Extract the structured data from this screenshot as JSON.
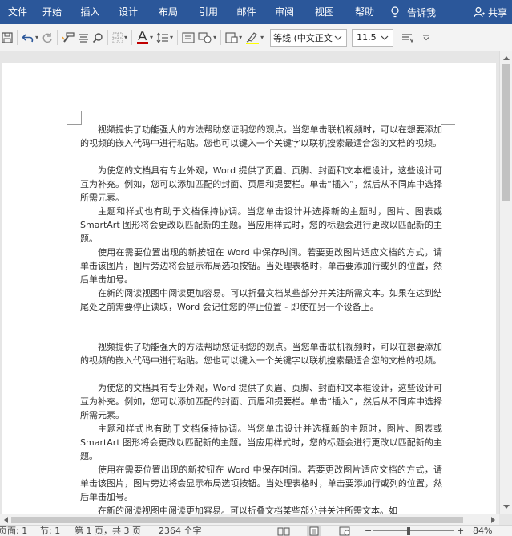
{
  "ribbon": {
    "tabs": [
      "文件",
      "开始",
      "插入",
      "设计",
      "布局",
      "引用",
      "邮件",
      "审阅",
      "视图",
      "帮助"
    ],
    "tell_me": "告诉我",
    "share": "共享"
  },
  "toolbar": {
    "font_name": "等线 (中文正文",
    "font_size": "11.5",
    "font_color": "#c00000",
    "highlight_color": "#ffff00"
  },
  "document": {
    "paragraphs": [
      "视频提供了功能强大的方法帮助您证明您的观点。当您单击联机视频时，可以在想要添加的视频的嵌入代码中进行粘贴。您也可以键入一个关键字以联机搜索最适合您的文档的视频。",
      "为使您的文档具有专业外观，Word 提供了页眉、页脚、封面和文本框设计，这些设计可互为补充。例如，您可以添加匹配的封面、页眉和提要栏。单击“插入”，然后从不同库中选择所需元素。",
      "主题和样式也有助于文档保持协调。当您单击设计并选择新的主题时，图片、图表或 SmartArt 图形将会更改以匹配新的主题。当应用样式时，您的标题会进行更改以匹配新的主题。",
      "使用在需要位置出现的新按钮在 Word 中保存时间。若要更改图片适应文档的方式，请单击该图片，图片旁边将会显示布局选项按钮。当处理表格时，单击要添加行或列的位置，然后单击加号。",
      "在新的阅读视图中阅读更加容易。可以折叠文档某些部分并关注所需文本。如果在达到结尾处之前需要停止读取，Word 会记住您的停止位置 - 即使在另一个设备上。",
      "视频提供了功能强大的方法帮助您证明您的观点。当您单击联机视频时，可以在想要添加的视频的嵌入代码中进行粘贴。您也可以键入一个关键字以联机搜索最适合您的文档的视频。",
      "为使您的文档具有专业外观，Word 提供了页眉、页脚、封面和文本框设计，这些设计可互为补充。例如，您可以添加匹配的封面、页眉和提要栏。单击“插入”，然后从不同库中选择所需元素。",
      "主题和样式也有助于文档保持协调。当您单击设计并选择新的主题时，图片、图表或 SmartArt 图形将会更改以匹配新的主题。当应用样式时，您的标题会进行更改以匹配新的主题。",
      "使用在需要位置出现的新按钮在 Word 中保存时间。若要更改图片适应文档的方式，请单击该图片，图片旁边将会显示布局选项按钮。当处理表格时，单击要添加行或列的位置，然后单击加号。",
      "在新的阅读视图中阅读更加容易。可以折叠文档某些部分并关注所需文本。如"
    ]
  },
  "status": {
    "page": "页面: 1",
    "section": "节: 1",
    "page_of": "第 1 页，共 3 页",
    "words": "2364 个字",
    "zoom": "84%",
    "zoom_level_percent": 84
  }
}
